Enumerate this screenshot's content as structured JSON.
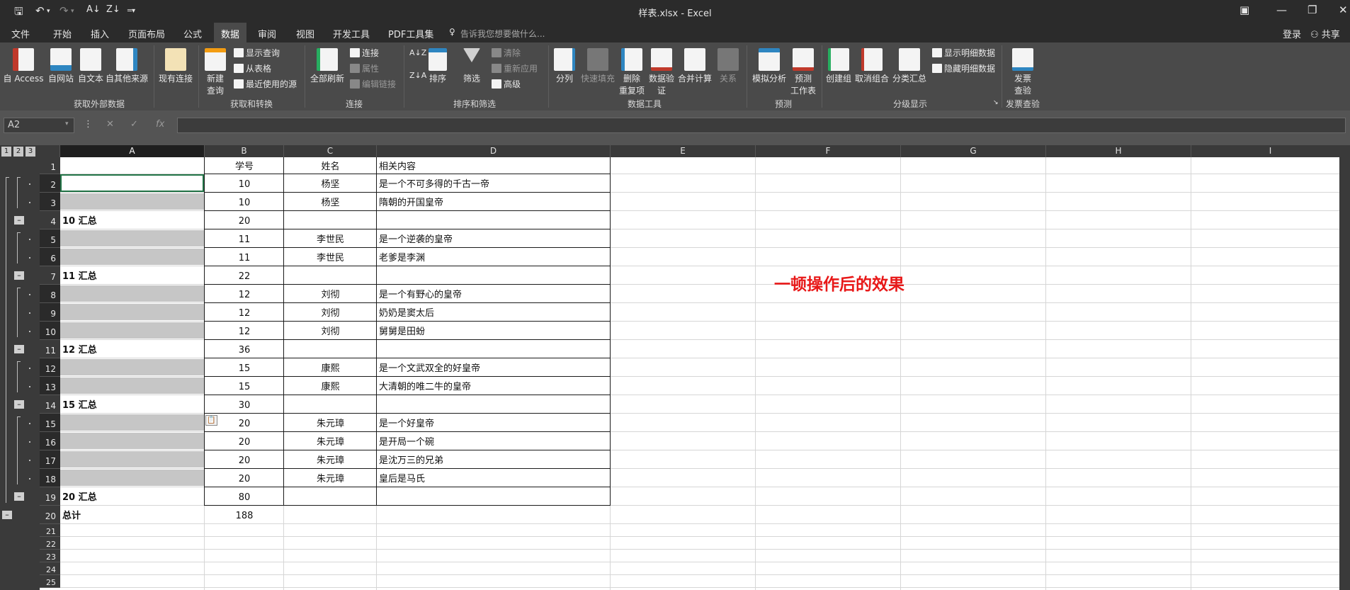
{
  "app": {
    "window_title": "样表.xlsx - Excel",
    "quick_access_icons": [
      "save-icon",
      "undo-icon",
      "redo-icon",
      "sort-asc-icon",
      "sort-desc-icon",
      "customize-icon"
    ],
    "window_controls": [
      "ribbon-display-icon",
      "minimize-icon",
      "restore-icon",
      "close-icon"
    ]
  },
  "menu": {
    "tabs": [
      "文件",
      "开始",
      "插入",
      "页面布局",
      "公式",
      "数据",
      "审阅",
      "视图",
      "开发工具",
      "PDF工具集"
    ],
    "active_tab": "数据",
    "tell_me": "告诉我您想要做什么...",
    "login": "登录",
    "share": "共享"
  },
  "ribbon": {
    "get_external": {
      "label": "获取外部数据",
      "buttons": [
        "自 Access",
        "自网站",
        "自文本",
        "自其他来源",
        "现有连接"
      ]
    },
    "get_transform": {
      "label": "获取和转换",
      "new_query": "新建\n查询",
      "small": [
        "显示查询",
        "从表格",
        "最近使用的源"
      ]
    },
    "connections": {
      "label": "连接",
      "refresh_all": "全部刷新",
      "small": [
        "连接",
        "属性",
        "编辑链接"
      ]
    },
    "sort_filter": {
      "label": "排序和筛选",
      "sort": "排序",
      "filter": "筛选",
      "small": [
        "清除",
        "重新应用",
        "高级"
      ]
    },
    "data_tools": {
      "label": "数据工具",
      "buttons": [
        "分列",
        "快速填充",
        "删除\n重复项",
        "数据验\n证",
        "合并计算",
        "关系"
      ]
    },
    "forecast": {
      "label": "预测",
      "buttons": [
        "模拟分析",
        "预测\n工作表"
      ]
    },
    "outline": {
      "label": "分级显示",
      "buttons": [
        "创建组",
        "取消组合",
        "分类汇总"
      ],
      "small": [
        "显示明细数据",
        "隐藏明细数据"
      ]
    },
    "invoice": {
      "label": "发票查验",
      "button": "发票\n查验"
    }
  },
  "formula_bar": {
    "name_box": "A2",
    "icons": [
      "more-icon",
      "cancel-icon",
      "enter-icon",
      "function-icon"
    ],
    "value": ""
  },
  "sheet": {
    "outline_levels": [
      "1",
      "2",
      "3"
    ],
    "columns": [
      "A",
      "B",
      "C",
      "D",
      "E",
      "F",
      "G",
      "H",
      "I"
    ],
    "selected_column": "A",
    "rows": [
      {
        "num": "1",
        "a": "",
        "b": "学号",
        "c": "姓名",
        "d": "相关内容"
      },
      {
        "num": "2",
        "a": "",
        "b": "10",
        "c": "杨坚",
        "d": "是一个不可多得的千古一帝"
      },
      {
        "num": "3",
        "a": "",
        "b": "10",
        "c": "杨坚",
        "d": "隋朝的开国皇帝"
      },
      {
        "num": "4",
        "a": "10  汇总",
        "b": "20",
        "c": "",
        "d": ""
      },
      {
        "num": "5",
        "a": "",
        "b": "11",
        "c": "李世民",
        "d": "是一个逆袭的皇帝"
      },
      {
        "num": "6",
        "a": "",
        "b": "11",
        "c": "李世民",
        "d": "老爹是李渊"
      },
      {
        "num": "7",
        "a": "11  汇总",
        "b": "22",
        "c": "",
        "d": ""
      },
      {
        "num": "8",
        "a": "",
        "b": "12",
        "c": "刘彻",
        "d": "是一个有野心的皇帝"
      },
      {
        "num": "9",
        "a": "",
        "b": "12",
        "c": "刘彻",
        "d": "奶奶是窦太后"
      },
      {
        "num": "10",
        "a": "",
        "b": "12",
        "c": "刘彻",
        "d": "舅舅是田蚡"
      },
      {
        "num": "11",
        "a": "12  汇总",
        "b": "36",
        "c": "",
        "d": ""
      },
      {
        "num": "12",
        "a": "",
        "b": "15",
        "c": "康熙",
        "d": "是一个文武双全的好皇帝"
      },
      {
        "num": "13",
        "a": "",
        "b": "15",
        "c": "康熙",
        "d": "大清朝的唯二牛的皇帝"
      },
      {
        "num": "14",
        "a": "15  汇总",
        "b": "30",
        "c": "",
        "d": ""
      },
      {
        "num": "15",
        "a": "",
        "b": "20",
        "c": "朱元璋",
        "d": "是一个好皇帝"
      },
      {
        "num": "16",
        "a": "",
        "b": "20",
        "c": "朱元璋",
        "d": "是开局一个碗"
      },
      {
        "num": "17",
        "a": "",
        "b": "20",
        "c": "朱元璋",
        "d": "是沈万三的兄弟"
      },
      {
        "num": "18",
        "a": "",
        "b": "20",
        "c": "朱元璋",
        "d": "皇后是马氏"
      },
      {
        "num": "19",
        "a": "20  汇总",
        "b": "80",
        "c": "",
        "d": ""
      },
      {
        "num": "20",
        "a": "总计",
        "b": "188",
        "c": "",
        "d": ""
      },
      {
        "num": "21",
        "a": "",
        "b": "",
        "c": "",
        "d": ""
      },
      {
        "num": "22",
        "a": "",
        "b": "",
        "c": "",
        "d": ""
      },
      {
        "num": "23",
        "a": "",
        "b": "",
        "c": "",
        "d": ""
      },
      {
        "num": "24",
        "a": "",
        "b": "",
        "c": "",
        "d": ""
      },
      {
        "num": "25",
        "a": "",
        "b": "",
        "c": "",
        "d": ""
      }
    ],
    "overlay_text": "一顿操作后的效果",
    "overlay_color": "#e81818",
    "accent_color": "#217346"
  }
}
